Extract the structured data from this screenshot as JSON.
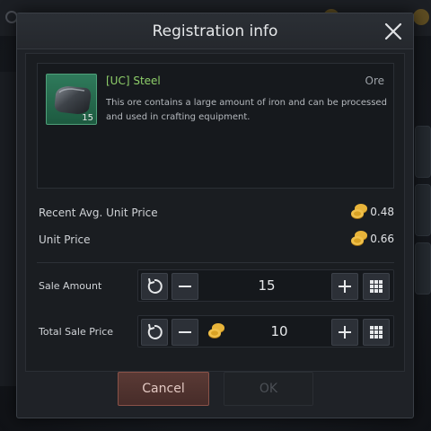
{
  "dialog": {
    "title": "Registration info"
  },
  "item": {
    "name": "[UC] Steel",
    "category": "Ore",
    "description": "This ore contains a large amount of iron and can be processed and used in crafting equipment.",
    "count": "15",
    "icon": "steel-ingot-icon"
  },
  "prices": {
    "recent_avg_label": "Recent Avg. Unit Price",
    "recent_avg_value": "0.48",
    "unit_price_label": "Unit Price",
    "unit_price_value": "0.66",
    "currency_icon": "gold-coin-icon"
  },
  "sale_amount": {
    "label": "Sale Amount",
    "value": "15"
  },
  "total_sale_price": {
    "label": "Total Sale Price",
    "value": "10"
  },
  "buttons": {
    "cancel": "Cancel",
    "ok": "OK"
  },
  "colors": {
    "item_name": "#8fd06a",
    "cancel_border": "#8a5248",
    "coin_gold": "#d9a224"
  }
}
